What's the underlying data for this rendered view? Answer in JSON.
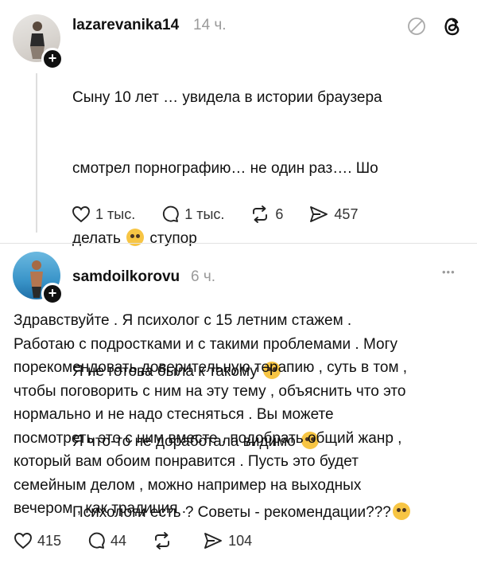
{
  "post1": {
    "username": "lazarevanika14",
    "time": "14 ч.",
    "text_lines": [
      "Сыну 10 лет … увидела в истории браузера",
      "смотрел порнографию… не один раз…. Шо",
      "делать",
      "ступор"
    ],
    "text_lines2": [
      "Я не готова была к такому",
      "Я что-то не доработала видимо",
      "Психологи есть ? Советы - рекомендации???"
    ],
    "likes": "1 тыс.",
    "comments": "1 тыс.",
    "reposts": "6",
    "shares": "457"
  },
  "post2": {
    "username": "samdoilkorovu",
    "time": "6 ч.",
    "text": "Здравствуйте . Я психолог с 15 летним стажем .\nРаботаю с подростками и с такими проблемами . Могу\nпорекомендовать доверительную терапию , суть в том ,\nчтобы поговорить с ним на эту тему , объяснить что это\nнормально и не надо стесняться . Вы можете\nпосмотреть это с ним вместе , подобрать общий жанр ,\nкоторый вам обоим понравится . Пусть это будет\nсемейным делом , можно например на выходных\nвечером , как традиция .",
    "likes": "415",
    "comments": "44",
    "shares": "104"
  },
  "icons": {
    "plus_symbol": "+",
    "more_symbol": "•••"
  },
  "colors": {
    "text": "#111111",
    "muted": "#9a9a9a",
    "divider": "#e2e2e2"
  }
}
